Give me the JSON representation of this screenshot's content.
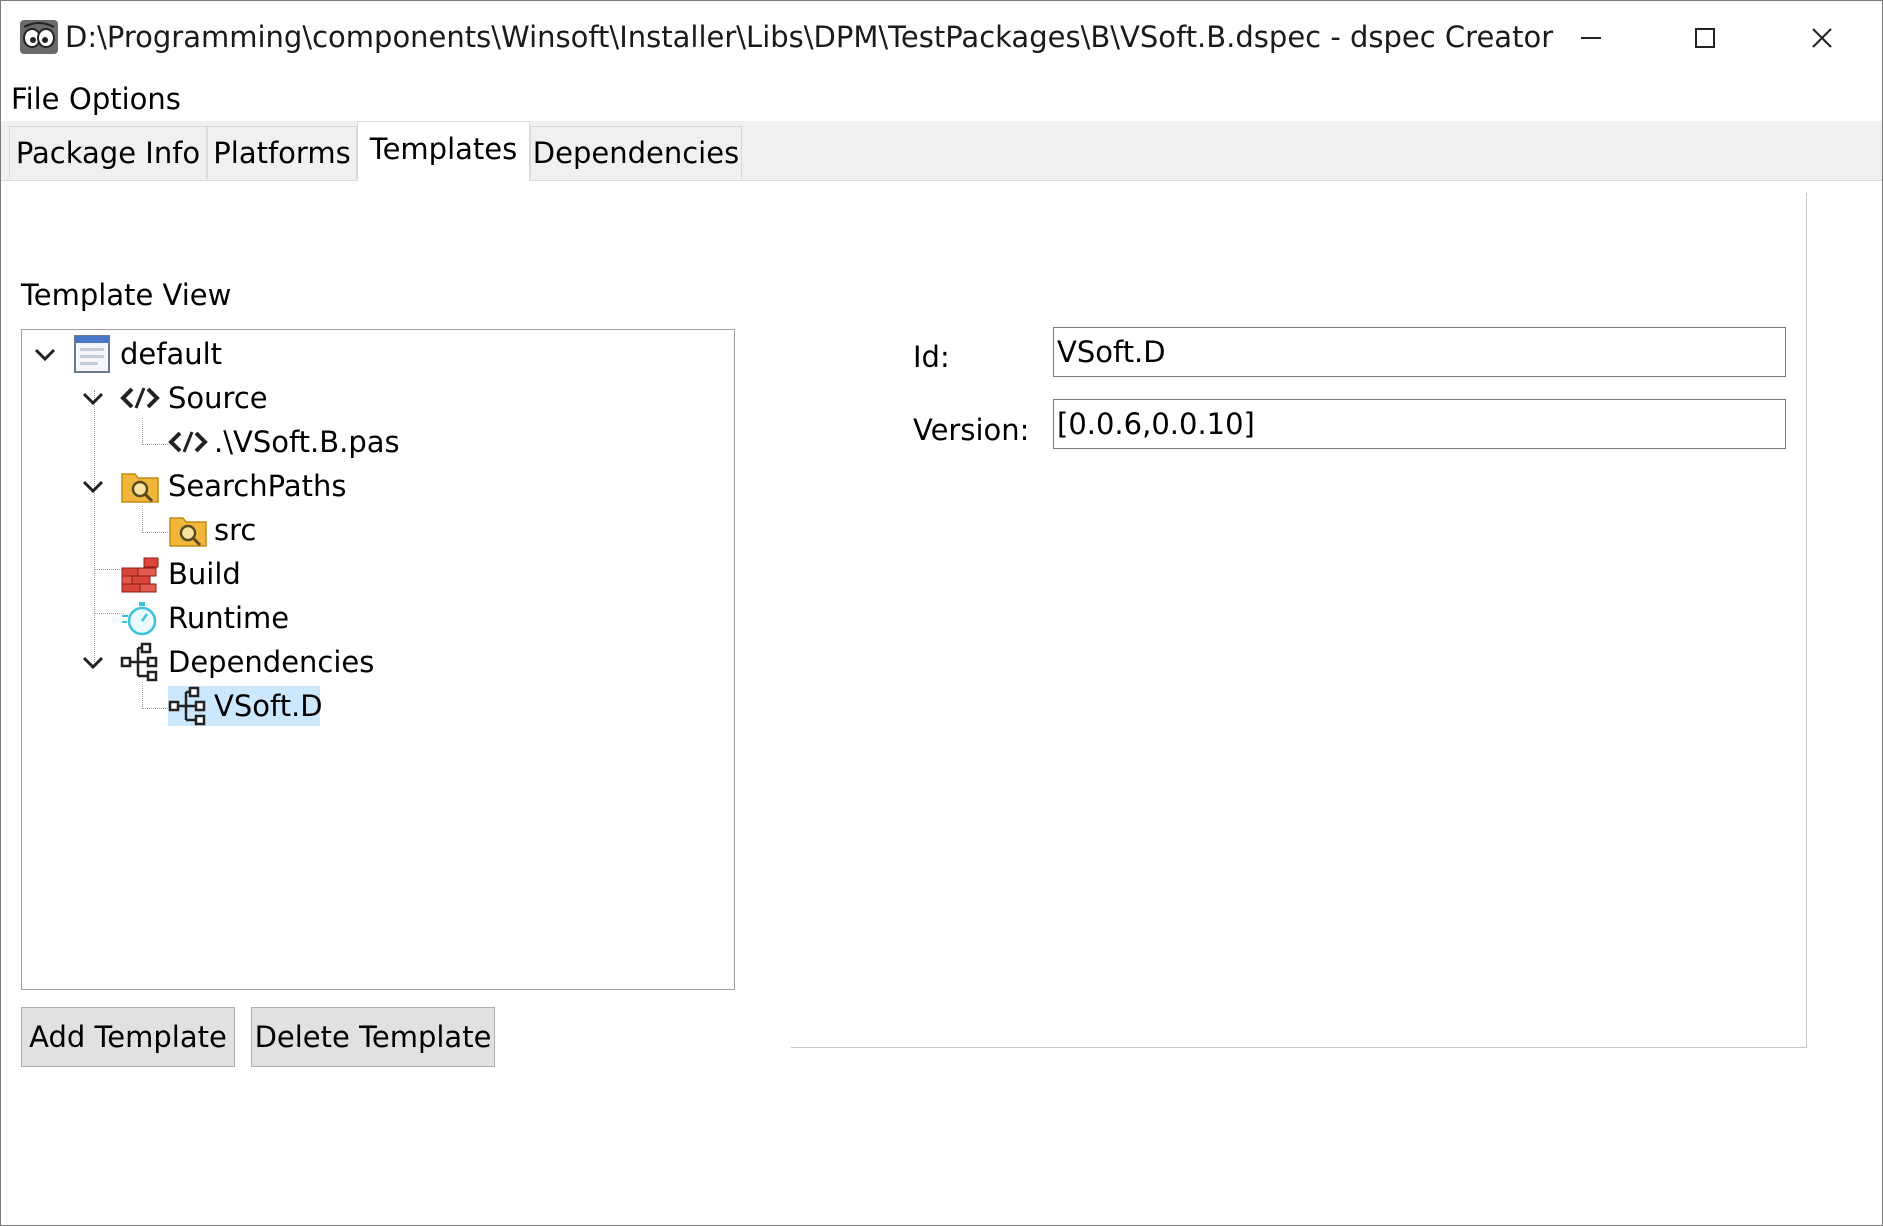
{
  "window": {
    "title": "D:\\Programming\\components\\Winsoft\\Installer\\Libs\\DPM\\TestPackages\\B\\VSoft.B.dspec - dspec Creator"
  },
  "menu": {
    "file": "File",
    "options": "Options"
  },
  "tabs": [
    {
      "label": "Package Info"
    },
    {
      "label": "Platforms"
    },
    {
      "label": "Templates"
    },
    {
      "label": "Dependencies"
    }
  ],
  "active_tab": "Templates",
  "template_view": {
    "label": "Template View",
    "tree": [
      {
        "label": "default",
        "icon": "template-icon",
        "expanded": true
      },
      {
        "label": "Source",
        "icon": "source-code-icon",
        "expanded": true
      },
      {
        "label": ".\\VSoft.B.pas",
        "icon": "source-code-icon"
      },
      {
        "label": "SearchPaths",
        "icon": "folder-search-icon",
        "expanded": true
      },
      {
        "label": "src",
        "icon": "folder-search-icon"
      },
      {
        "label": "Build",
        "icon": "build-bricks-icon"
      },
      {
        "label": "Runtime",
        "icon": "stopwatch-icon"
      },
      {
        "label": "Dependencies",
        "icon": "dependency-tree-icon",
        "expanded": true
      },
      {
        "label": "VSoft.D",
        "icon": "dependency-tree-icon",
        "selected": true
      }
    ]
  },
  "buttons": {
    "add_template": "Add Template",
    "delete_template": "Delete Template"
  },
  "details": {
    "id_label": "Id:",
    "id_value": "VSoft.D",
    "version_label": "Version:",
    "version_value": "[0.0.6,0.0.10]"
  },
  "colors": {
    "selection": "#cce8ff",
    "tab_strip": "#f0f0f0",
    "button_face": "#e1e1e1"
  }
}
